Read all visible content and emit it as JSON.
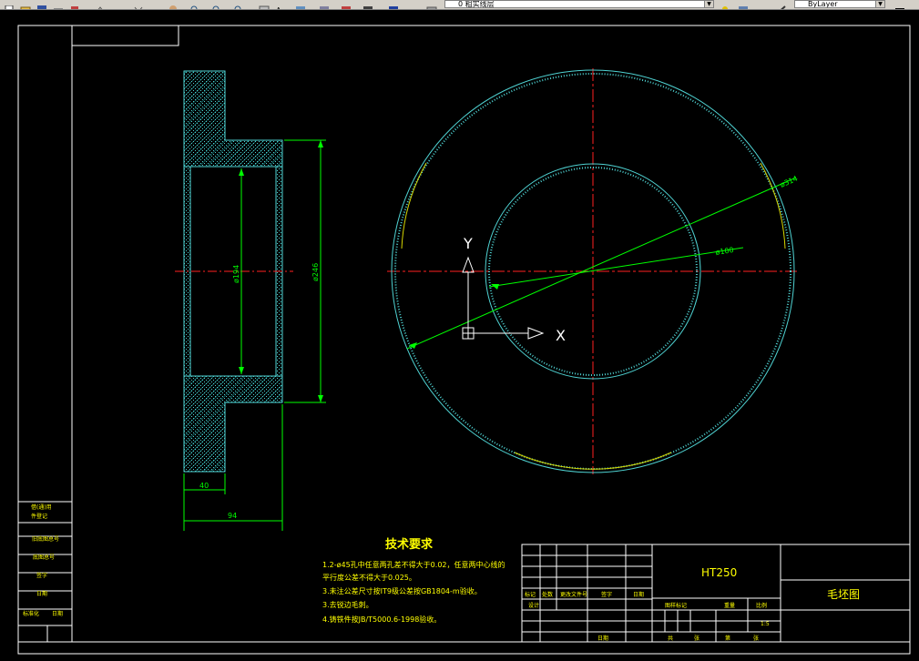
{
  "toolbar": {
    "layer_combo_value": "0 粗实线层",
    "linetype_combo_value": "ByLayer",
    "colors": {
      "bar": "#d4d0c8"
    }
  },
  "drawing": {
    "colors": {
      "background": "#000000",
      "frame": "#ffffff",
      "outline": "#4fd3d3",
      "hatch": "#1fa6a6",
      "dimension": "#00ff00",
      "centerline": "#ff2020",
      "text": "#ffff00",
      "hidden": "#d6d600"
    },
    "dims": {
      "d194": "ø194",
      "d246": "ø246",
      "w40": "40",
      "w94": "94",
      "d100": "ø100",
      "d314": "ø314"
    },
    "ucs": {
      "x_label": "X",
      "y_label": "Y"
    },
    "tech_title": "技术要求",
    "tech_notes": [
      "1.2-ø45孔中任意两孔差不得大于0.02，任意两中心线的",
      "平行度公差不得大于0.025。",
      "3.未注公差尺寸按IT9级公差按GB1804-m验收。",
      "3.去锐边毛刺。",
      "4.铸铁件按JB/T5000.6-1998验收。"
    ],
    "material": "HT250",
    "part_name": "毛坯图",
    "title_block": {
      "row_labels": [
        "标记",
        "处数",
        "更改文件号",
        "签字",
        "日期"
      ],
      "design_label": "设计",
      "date_label": "日期",
      "stage_label": "图样标记",
      "weight_label": "重量",
      "scale_label": "比例",
      "scale_value": "1:5",
      "total_label": "共",
      "sheet_label": "张",
      "page_label": "第"
    },
    "side_labels": [
      "借(通)用",
      "件登记",
      "旧底图总号",
      "底图总号",
      "签字",
      "日期",
      "标准化",
      "日期"
    ]
  }
}
